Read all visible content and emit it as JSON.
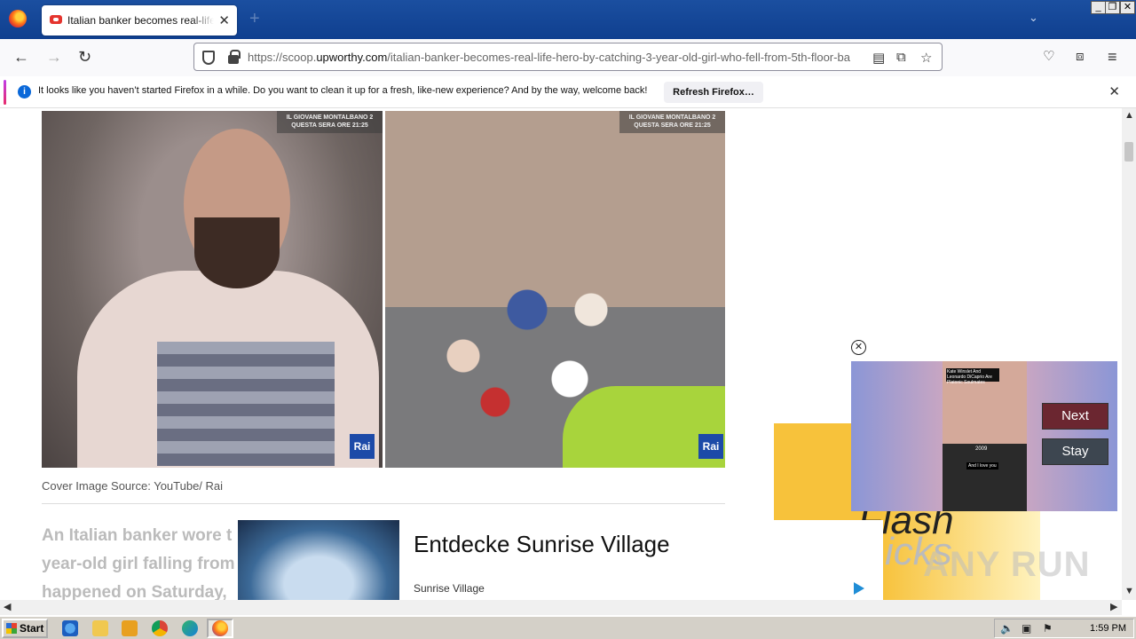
{
  "browser": {
    "tab_title": "Italian banker becomes real-life hero",
    "url_prefix": "https://scoop.",
    "url_domain": "upworthy.com",
    "url_path": "/italian-banker-becomes-real-life-hero-by-catching-3-year-old-girl-who-fell-from-5th-floor-ba"
  },
  "notification": {
    "message": "It looks like you haven’t started Firefox in a while. Do you want to clean it up for a fresh, like-new experience? And by the way, welcome back!",
    "button": "Refresh Firefox…"
  },
  "article": {
    "watermark": "IL GIOVANE MONTALBANO 2\nQUESTA SERA ORE 21:25",
    "rai_logo": "Rai",
    "caption": "Cover Image Source: YouTube/ Rai",
    "body_line1": "An Italian banker wore t",
    "body_line2": "year-old girl falling from",
    "body_line3": "happened on Saturday,"
  },
  "side_ad": {
    "text1": "Flash",
    "text2": "icks"
  },
  "video_popup": {
    "caption": "Kate Winslet And Leonardo DiCaprio Are Platonic Soulmates",
    "year": "2009",
    "subtitle": "And I love you",
    "next_label": "Next",
    "stay_label": "Stay"
  },
  "bottom_ad": {
    "title": "Entdecke Sunrise Village",
    "sponsor": "Sunrise Village"
  },
  "watermark_brand": "ANY RUN",
  "taskbar": {
    "start_label": "Start",
    "clock": "1:59 PM"
  }
}
